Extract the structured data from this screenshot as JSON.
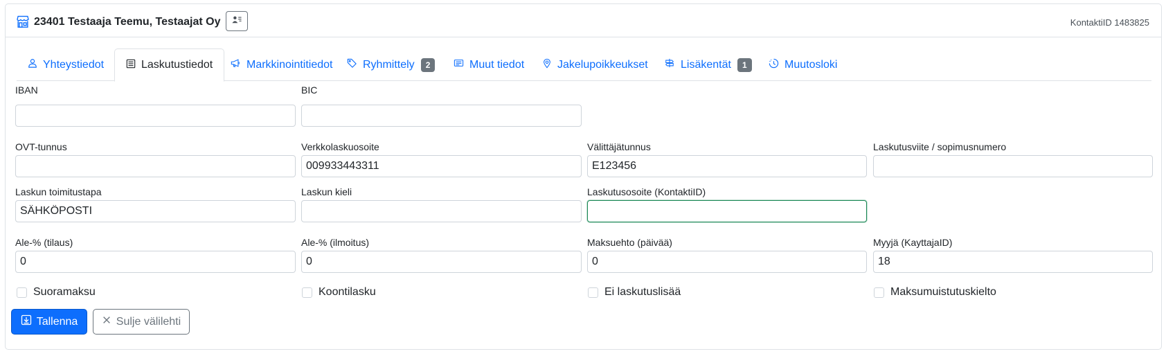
{
  "header": {
    "title": "23401 Testaaja Teemu, Testaajat Oy",
    "contact_id": "KontaktiID 1483825"
  },
  "tabs": [
    {
      "label": "Yhteystiedot",
      "icon": "person-icon",
      "active": false
    },
    {
      "label": "Laskutustiedot",
      "icon": "invoice-icon",
      "active": true
    },
    {
      "label": "Markkinointitiedot",
      "icon": "megaphone-icon",
      "active": false
    },
    {
      "label": "Ryhmittely",
      "icon": "tags-icon",
      "active": false,
      "badge": "2"
    },
    {
      "label": "Muut tiedot",
      "icon": "card-text-icon",
      "active": false
    },
    {
      "label": "Jakelupoikkeukset",
      "icon": "geo-pin-icon",
      "active": false
    },
    {
      "label": "Lisäkentät",
      "icon": "signpost-icon",
      "active": false,
      "badge": "1"
    },
    {
      "label": "Muutosloki",
      "icon": "clock-history-icon",
      "active": false
    }
  ],
  "form": {
    "iban": {
      "label": "IBAN",
      "value": ""
    },
    "bic": {
      "label": "BIC",
      "value": ""
    },
    "ovt": {
      "label": "OVT-tunnus",
      "value": ""
    },
    "verkkolaskuosoite": {
      "label": "Verkkolaskuosoite",
      "value": "009933443311"
    },
    "valittajatunnus": {
      "label": "Välittäjätunnus",
      "value": "E123456"
    },
    "laskutusviite": {
      "label": "Laskutusviite / sopimusnumero",
      "value": ""
    },
    "toimitustapa": {
      "label": "Laskun toimitustapa",
      "value": "SÄHKÖPOSTI"
    },
    "kieli": {
      "label": "Laskun kieli",
      "value": ""
    },
    "laskutusosoite": {
      "label": "Laskutusosoite (KontaktiID)",
      "value": ""
    },
    "ale_tilaus": {
      "label": "Ale-% (tilaus)",
      "value": "0"
    },
    "ale_ilmoitus": {
      "label": "Ale-% (ilmoitus)",
      "value": "0"
    },
    "maksuehto": {
      "label": "Maksuehto (päivää)",
      "value": "0"
    },
    "myyja": {
      "label": "Myyjä (KayttajaID)",
      "value": "18"
    }
  },
  "checkboxes": [
    {
      "label": "Suoramaksu",
      "checked": false
    },
    {
      "label": "Koontilasku",
      "checked": false
    },
    {
      "label": "Ei laskutuslisää",
      "checked": false
    },
    {
      "label": "Maksumuistutuskielto",
      "checked": false
    }
  ],
  "actions": {
    "save_label": "Tallenna",
    "close_label": "Sulje välilehti"
  },
  "colors": {
    "primary": "#0d6efd",
    "focus_border": "#198754",
    "badge": "#6c757d"
  }
}
